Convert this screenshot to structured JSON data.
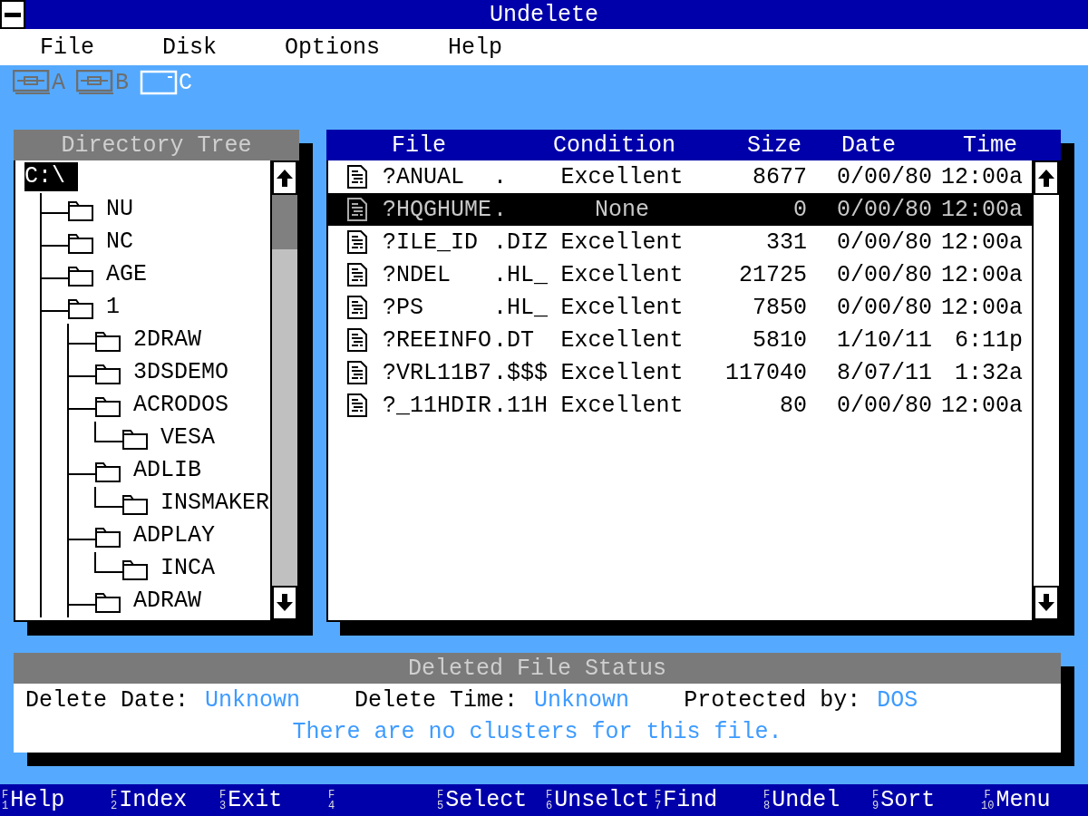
{
  "window": {
    "title": "Undelete"
  },
  "menu": [
    "File",
    "Disk",
    "Options",
    "Help"
  ],
  "drives": [
    {
      "letter": "A",
      "kind": "floppy",
      "selected": false
    },
    {
      "letter": "B",
      "kind": "floppy",
      "selected": false
    },
    {
      "letter": "C",
      "kind": "hard",
      "selected": true
    }
  ],
  "tree": {
    "title": "Directory Tree",
    "root": {
      "label": "C:\\",
      "selected": true,
      "children": [
        {
          "label": "NU",
          "selected": false
        },
        {
          "label": "NC",
          "selected": false
        },
        {
          "label": "AGE",
          "selected": false
        },
        {
          "label": "1",
          "selected": false,
          "children": [
            {
              "label": "2DRAW",
              "selected": false
            },
            {
              "label": "3DSDEMO",
              "selected": false
            },
            {
              "label": "ACRODOS",
              "selected": false,
              "children": [
                {
                  "label": "VESA",
                  "selected": false
                }
              ]
            },
            {
              "label": "ADLIB",
              "selected": false,
              "children": [
                {
                  "label": "INSMAKER",
                  "selected": false
                }
              ]
            },
            {
              "label": "ADPLAY",
              "selected": false,
              "children": [
                {
                  "label": "INCA",
                  "selected": false
                }
              ]
            },
            {
              "label": "ADRAW",
              "selected": false
            }
          ]
        }
      ]
    }
  },
  "files": {
    "columns": [
      "File",
      "Condition",
      "Size",
      "Date",
      "Time"
    ],
    "rows": [
      {
        "name": "?ANUAL",
        "ext": ".",
        "condition": "Excellent",
        "size": "8677",
        "date": "0/00/80",
        "time": "12:00a",
        "selected": false
      },
      {
        "name": "?HQGHUME",
        "ext": ".",
        "condition": "None",
        "size": "0",
        "date": "0/00/80",
        "time": "12:00a",
        "selected": true
      },
      {
        "name": "?ILE_ID",
        "ext": ".DIZ",
        "condition": "Excellent",
        "size": "331",
        "date": "0/00/80",
        "time": "12:00a",
        "selected": false
      },
      {
        "name": "?NDEL",
        "ext": ".HL_",
        "condition": "Excellent",
        "size": "21725",
        "date": "0/00/80",
        "time": "12:00a",
        "selected": false
      },
      {
        "name": "?PS",
        "ext": ".HL_",
        "condition": "Excellent",
        "size": "7850",
        "date": "0/00/80",
        "time": "12:00a",
        "selected": false
      },
      {
        "name": "?REEINFO",
        "ext": ".DT",
        "condition": "Excellent",
        "size": "5810",
        "date": "1/10/11",
        "time": "6:11p",
        "selected": false
      },
      {
        "name": "?VRL11B7",
        "ext": ".$$$",
        "condition": "Excellent",
        "size": "117040",
        "date": "8/07/11",
        "time": "1:32a",
        "selected": false
      },
      {
        "name": "?_11HDIR",
        "ext": ".11H",
        "condition": "Excellent",
        "size": "80",
        "date": "0/00/80",
        "time": "12:00a",
        "selected": false
      }
    ]
  },
  "status": {
    "title": "Deleted File Status",
    "fields": [
      {
        "label": "Delete Date:",
        "value": "Unknown"
      },
      {
        "label": "Delete Time:",
        "value": "Unknown"
      },
      {
        "label": "Protected by:",
        "value": "DOS"
      }
    ],
    "message": "There are no clusters for this file."
  },
  "function_keys": [
    {
      "key": "F1",
      "label": "Help"
    },
    {
      "key": "F2",
      "label": "Index"
    },
    {
      "key": "F3",
      "label": "Exit"
    },
    {
      "key": "F4"
    },
    {
      "key": "F5",
      "label": "Select"
    },
    {
      "key": "F6",
      "label": "Unselct"
    },
    {
      "key": "F7",
      "label": "Find"
    },
    {
      "key": "F8",
      "label": "Undel"
    },
    {
      "key": "F9",
      "label": "Sort"
    },
    {
      "key": "F10",
      "label": "Menu"
    }
  ]
}
